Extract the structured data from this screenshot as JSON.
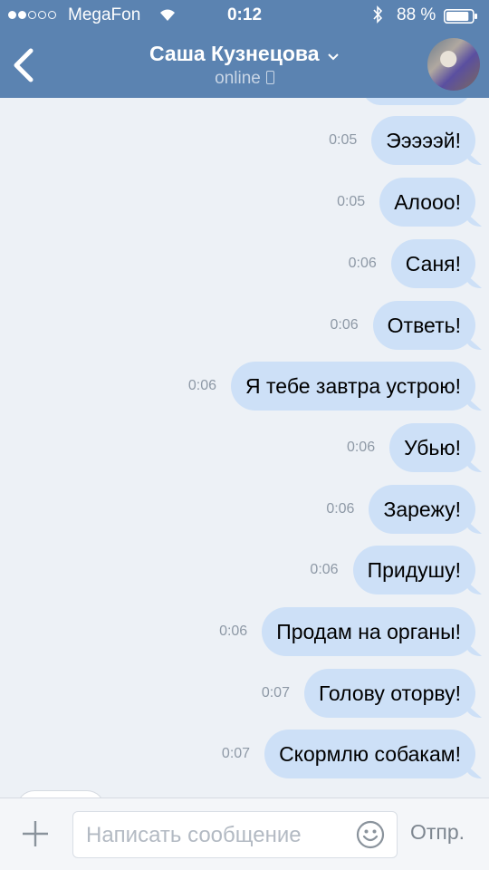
{
  "status_bar": {
    "carrier": "MegaFon",
    "time": "0:12",
    "battery_percent": "88 %",
    "signal_bars": 2,
    "battery_level": 0.88
  },
  "header": {
    "title": "Саша Кузнецова",
    "subtitle": "online"
  },
  "messages": [
    {
      "time": "0:05",
      "text": "Эээээй!"
    },
    {
      "time": "0:05",
      "text": "Алооо!"
    },
    {
      "time": "0:06",
      "text": "Саня!"
    },
    {
      "time": "0:06",
      "text": "Ответь!"
    },
    {
      "time": "0:06",
      "text": "Я тебе завтра устрою!"
    },
    {
      "time": "0:06",
      "text": "Убью!"
    },
    {
      "time": "0:06",
      "text": "Зарежу!"
    },
    {
      "time": "0:06",
      "text": "Придушу!"
    },
    {
      "time": "0:06",
      "text": "Продам на органы!"
    },
    {
      "time": "0:07",
      "text": "Голову оторву!"
    },
    {
      "time": "0:07",
      "text": "Скормлю собакам!"
    }
  ],
  "composer": {
    "placeholder": "Написать сообщение",
    "send_label": "Отпр."
  },
  "colors": {
    "header": "#5b83b1",
    "outgoing_bubble": "#cde0f7",
    "background": "#edf1f6"
  }
}
